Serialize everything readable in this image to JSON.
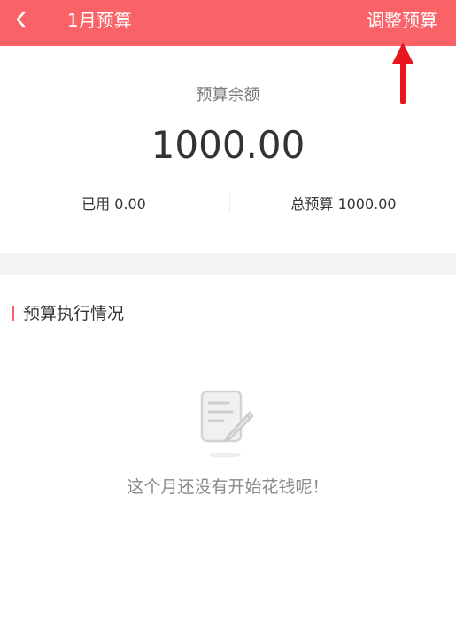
{
  "header": {
    "back_icon": "chevron-left-icon",
    "title": "1月预算",
    "action_label": "调整预算",
    "background_color": "#f96266"
  },
  "summary": {
    "balance_label": "预算余额",
    "balance_value": "1000.00",
    "used_text": "已用 0.00",
    "total_text": "总预算 1000.00"
  },
  "execution": {
    "section_title": "预算执行情况",
    "empty_icon": "note-edit-icon",
    "empty_message": "这个月还没有开始花钱呢！"
  },
  "annotation": {
    "arrow_icon": "red-up-arrow-icon",
    "color": "#e8141e"
  }
}
